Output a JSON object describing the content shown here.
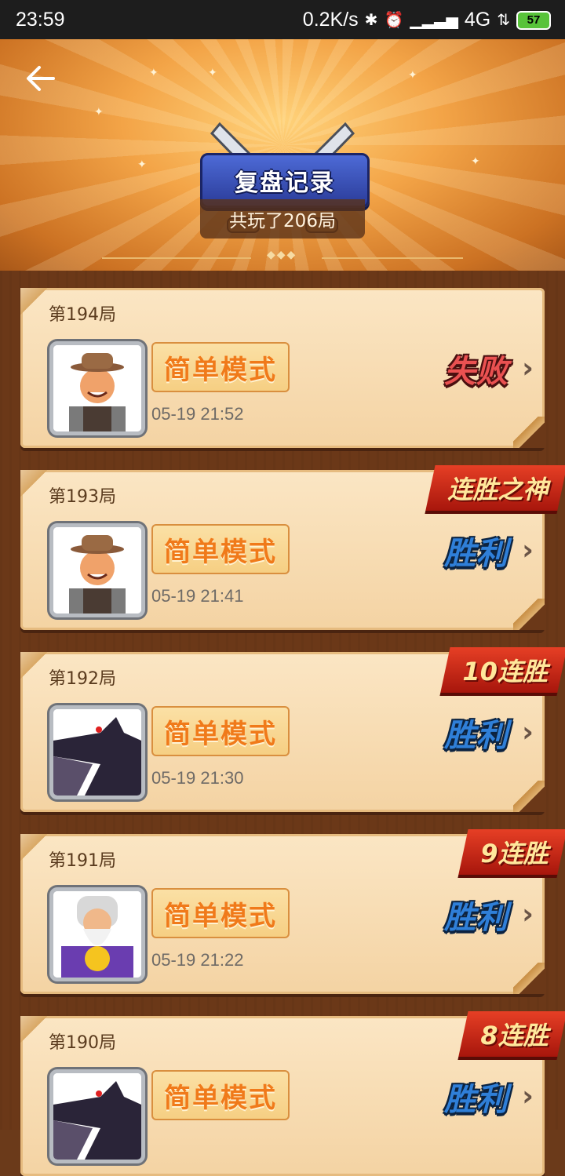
{
  "status_bar": {
    "time": "23:59",
    "network_speed": "0.2K/s",
    "network_type": "4G",
    "battery": "57",
    "icons": [
      "bluetooth-icon",
      "alarm-icon",
      "signal-icon",
      "wifi-icon",
      "battery-icon"
    ]
  },
  "header": {
    "title": "复盘记录",
    "total_games": "共玩了206局"
  },
  "colors": {
    "accent": "#f07a1a",
    "win": "#2f7fd8",
    "lose": "#ea5151",
    "streak": "#d3291a"
  },
  "games": [
    {
      "round": "第194局",
      "mode": "简单模式",
      "datetime": "05-19 21:52",
      "result": "失败",
      "result_type": "lose",
      "streak": "",
      "avatar": "farmer"
    },
    {
      "round": "第193局",
      "mode": "简单模式",
      "datetime": "05-19 21:41",
      "result": "胜利",
      "result_type": "win",
      "streak": "连胜之神",
      "avatar": "farmer"
    },
    {
      "round": "第192局",
      "mode": "简单模式",
      "datetime": "05-19 21:30",
      "result": "胜利",
      "result_type": "win",
      "streak": "10连胜",
      "avatar": "wolf"
    },
    {
      "round": "第191局",
      "mode": "简单模式",
      "datetime": "05-19 21:22",
      "result": "胜利",
      "result_type": "win",
      "streak": "9连胜",
      "avatar": "wizard"
    },
    {
      "round": "第190局",
      "mode": "简单模式",
      "datetime": "",
      "result": "胜利",
      "result_type": "win",
      "streak": "8连胜",
      "avatar": "wolf"
    }
  ]
}
